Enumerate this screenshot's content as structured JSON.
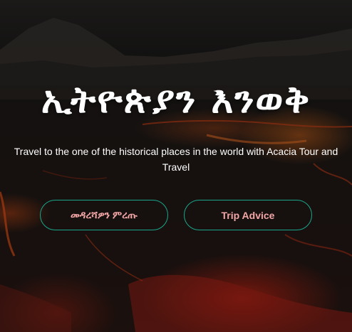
{
  "hero": {
    "headline": "ኢትዮጵያን እንወቅ",
    "subtitle": "Travel to the one of the historical places in the world with Acacia Tour and Travel",
    "primary_button": "መዳረሻዎን ምረጡ",
    "secondary_button": "Trip Advice"
  },
  "colors": {
    "button_border": "#1aa68a",
    "button_text": "#f2a6a6",
    "headline": "#ffffff"
  }
}
